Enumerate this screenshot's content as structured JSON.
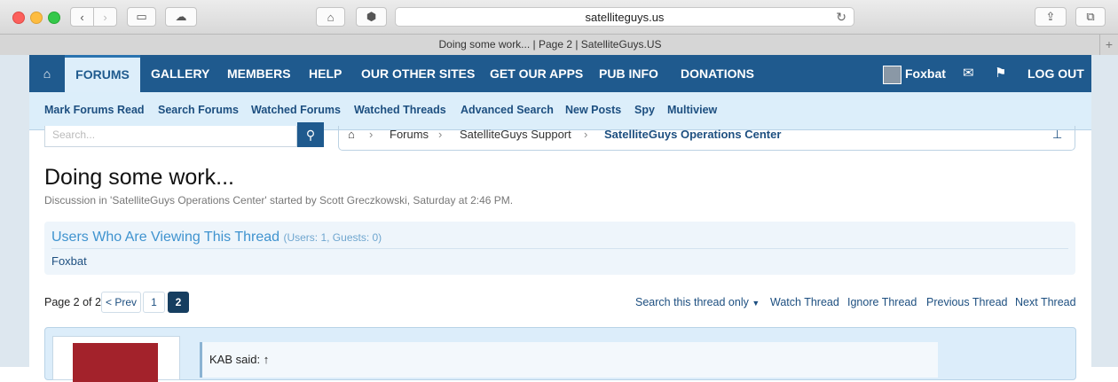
{
  "browser": {
    "url": "satelliteguys.us",
    "tab_title": "Doing some work... | Page 2 | SatelliteGuys.US"
  },
  "nav": {
    "items": [
      "FORUMS",
      "GALLERY",
      "MEMBERS",
      "HELP",
      "OUR OTHER SITES",
      "GET OUR APPS",
      "PUB INFO",
      "DONATIONS"
    ],
    "username": "Foxbat",
    "logout": "LOG OUT"
  },
  "subnav": [
    "Mark Forums Read",
    "Search Forums",
    "Watched Forums",
    "Watched Threads",
    "Advanced Search",
    "New Posts",
    "Spy",
    "Multiview"
  ],
  "search": {
    "placeholder": "Search..."
  },
  "breadcrumb": [
    "Forums",
    "SatelliteGuys Support",
    "SatelliteGuys Operations Center"
  ],
  "thread": {
    "title": "Doing some work...",
    "subtitle": "Discussion in 'SatelliteGuys Operations Center' started by Scott Greczkowski, Saturday at 2:46 PM."
  },
  "viewers": {
    "heading": "Users Who Are Viewing This Thread",
    "counts": "(Users: 1, Guests: 0)",
    "user": "Foxbat"
  },
  "pagination": {
    "label": "Page 2 of 2",
    "prev": "< Prev",
    "pages": [
      "1",
      "2"
    ],
    "current": "2"
  },
  "thread_tools": [
    "Search this thread only",
    "Watch Thread",
    "Ignore Thread",
    "Previous Thread",
    "Next Thread"
  ],
  "post": {
    "quote_attribution": "KAB said: ↑"
  },
  "colors": {
    "nav_bg": "#1f5a8e",
    "subnav_bg": "#dceefa",
    "link": "#1d4f80"
  }
}
